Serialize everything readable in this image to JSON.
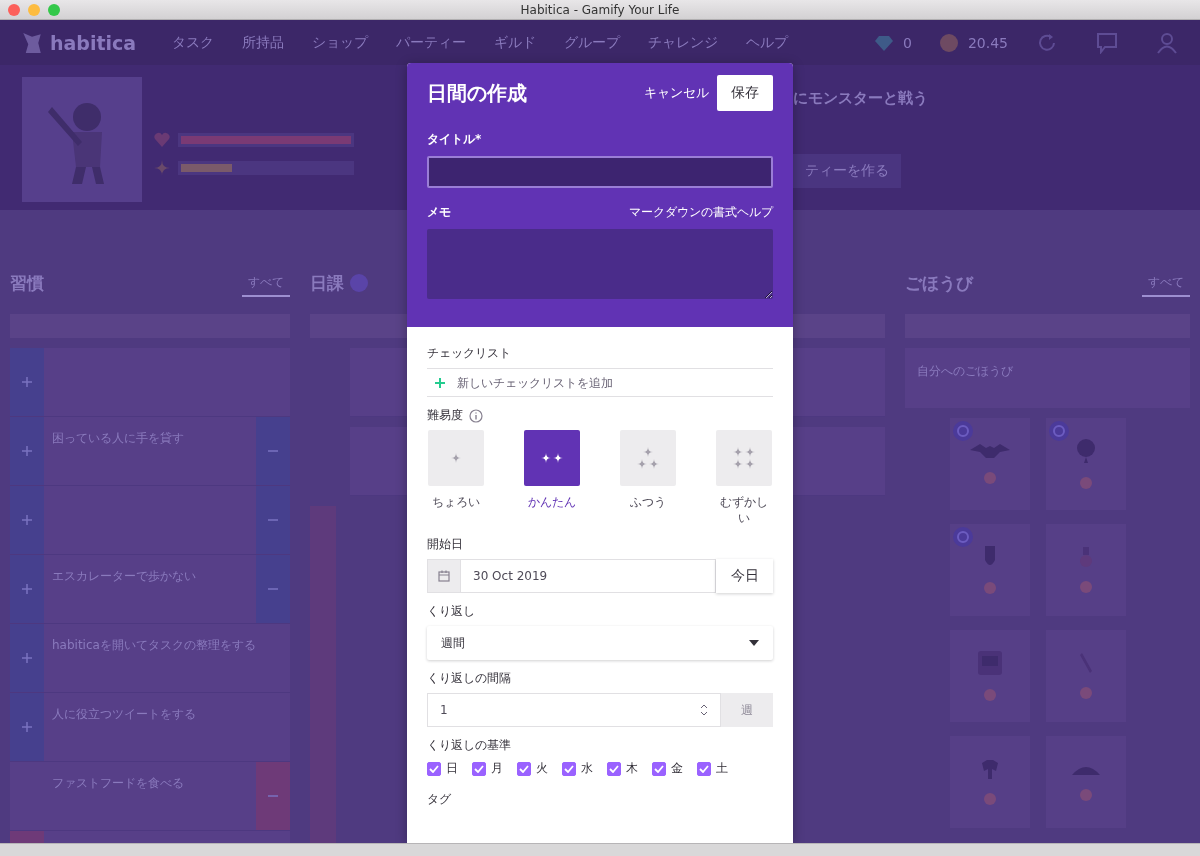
{
  "window": {
    "title": "Habitica - Gamify Your Life"
  },
  "nav": {
    "logo": "habitica",
    "items": [
      "タスク",
      "所持品",
      "ショップ",
      "パーティー",
      "ギルド",
      "グループ",
      "チャレンジ",
      "ヘルプ"
    ],
    "gems": "0",
    "gold": "20.45"
  },
  "profile": {
    "bars": [
      {
        "kind": "health",
        "level": 1
      },
      {
        "kind": "experience",
        "level": 0.3
      }
    ]
  },
  "party_prompt": {
    "title": "にモンスターと戦う",
    "button": "ティーを作る"
  },
  "habits": {
    "title": "習慣",
    "tabs": [
      {
        "label": "すべて",
        "selected": true
      }
    ],
    "cards": [
      {
        "plus": true,
        "minus": false,
        "color": "#46408e"
      },
      {
        "title": "困っている人に手を貸す",
        "plus": true,
        "minus": true,
        "color": "#46408e"
      },
      {
        "plus": true,
        "minus": true,
        "color": "#46408e"
      },
      {
        "title": "エスカレーターで歩かない",
        "plus": true,
        "minus": true,
        "color": "#46408e"
      },
      {
        "title": "habiticaを開いてタスクの整理をする",
        "plus": true,
        "minus": false,
        "color": "#46408e"
      },
      {
        "title": "人に役立つツイートをする",
        "plus": true,
        "minus": false,
        "color": "#46408e"
      },
      {
        "title": "ファストフードを食べる",
        "plus": false,
        "minus": true,
        "color": "#6e3a78"
      },
      {
        "plus": true,
        "minus": false,
        "color": "#6e3a78"
      }
    ]
  },
  "dailies": {
    "title": "日課"
  },
  "rewards": {
    "title": "ごほうび",
    "tabs": [
      {
        "label": "すべて",
        "selected": true
      }
    ],
    "custom": {
      "title": "自分へのごほうび"
    },
    "items": [
      {
        "kind": "bat",
        "pinned": true
      },
      {
        "kind": "balloon",
        "pinned": true
      },
      {
        "kind": "shield",
        "pinned": true
      },
      {
        "kind": "potion",
        "pinned": false
      },
      {
        "kind": "chest",
        "pinned": false
      },
      {
        "kind": "sword",
        "pinned": false
      },
      {
        "kind": "armor",
        "pinned": false
      },
      {
        "kind": "helmet",
        "pinned": false
      }
    ]
  },
  "modal": {
    "title": "日間の作成",
    "cancel": "キャンセル",
    "save": "保存",
    "title_label": "タイトル*",
    "notes_label": "メモ",
    "markdown_help": "マークダウンの書式ヘルプ",
    "checklist": {
      "label": "チェックリスト",
      "add_placeholder": "新しいチェックリストを追加"
    },
    "difficulty": {
      "label": "難易度",
      "options": [
        {
          "kind": "trivial",
          "label": "ちょろい",
          "selected": false
        },
        {
          "kind": "easy",
          "label": "かんたん",
          "selected": true
        },
        {
          "kind": "medium",
          "label": "ふつう",
          "selected": false
        },
        {
          "kind": "hard",
          "label": "むずかしい",
          "selected": false
        }
      ]
    },
    "start_date": {
      "label": "開始日",
      "value": "30 Oct 2019",
      "today": "今日"
    },
    "repeats": {
      "label": "くり返し",
      "value": "週間"
    },
    "every": {
      "label": "くり返しの間隔",
      "value": "1",
      "unit": "週"
    },
    "repeat_on": {
      "label": "くり返しの基準",
      "days": [
        {
          "label": "日",
          "checked": true
        },
        {
          "label": "月",
          "checked": true
        },
        {
          "label": "火",
          "checked": true
        },
        {
          "label": "水",
          "checked": true
        },
        {
          "label": "木",
          "checked": true
        },
        {
          "label": "金",
          "checked": true
        },
        {
          "label": "土",
          "checked": true
        }
      ]
    },
    "tags": {
      "label": "タグ"
    }
  }
}
